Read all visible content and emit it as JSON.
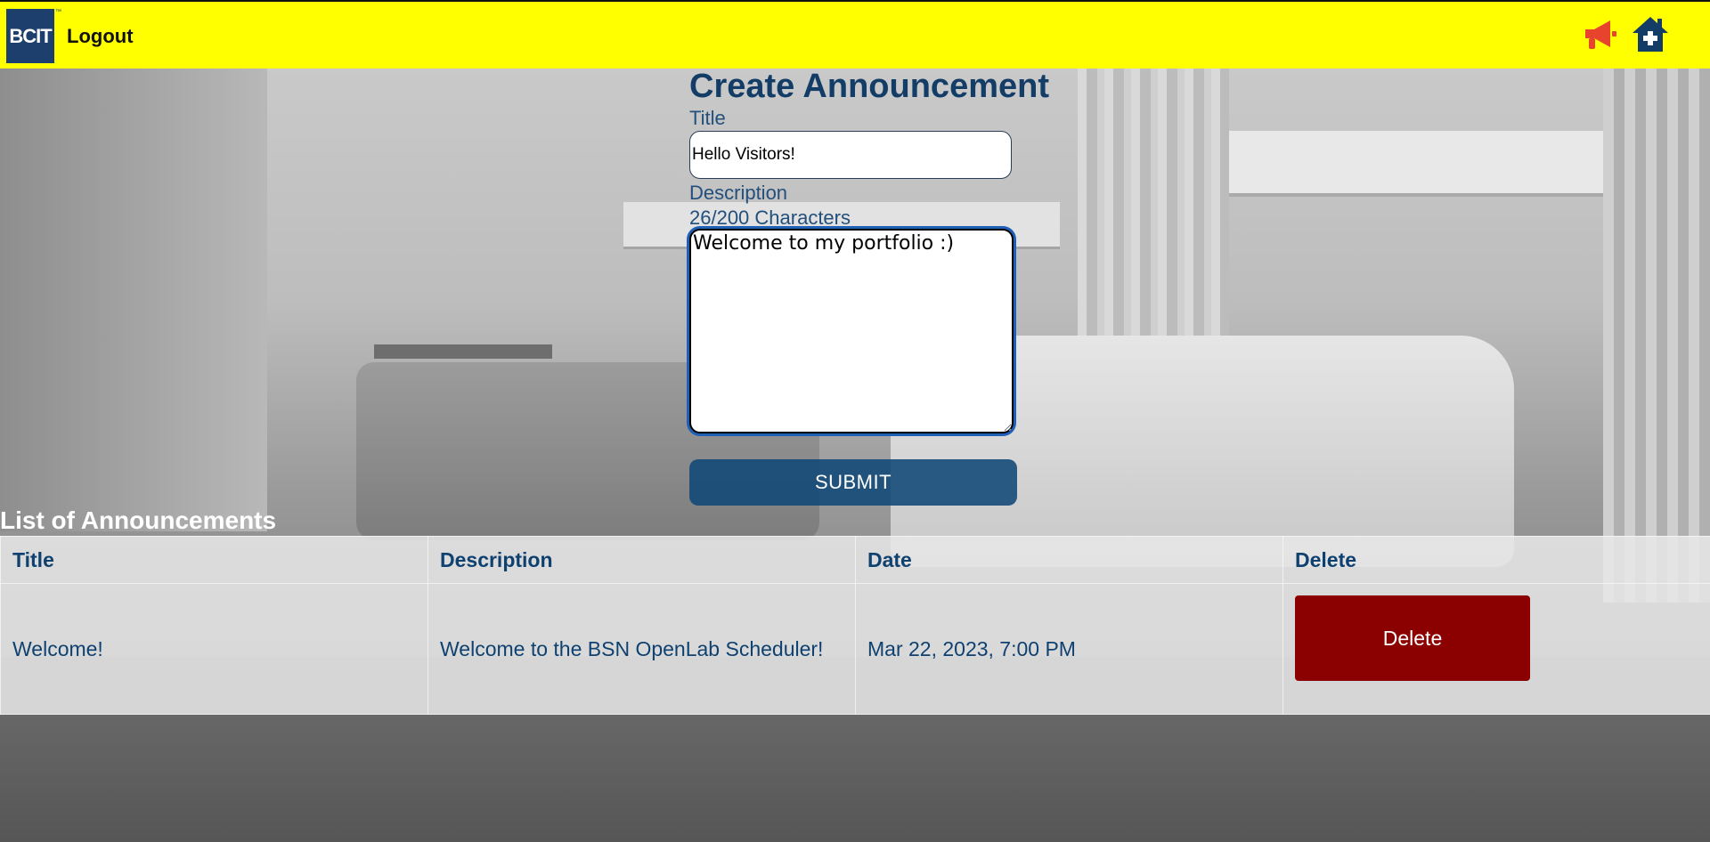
{
  "header": {
    "logo_text": "BCIT",
    "logo_tm": "™",
    "logout_label": "Logout",
    "icons": [
      "megaphone-icon",
      "home-plus-icon"
    ],
    "colors": {
      "background": "#ffff00",
      "megaphone": "#e8432d",
      "home": "#133c66"
    }
  },
  "form": {
    "heading": "Create Announcement",
    "title_label": "Title",
    "title_value": "Hello Visitors!",
    "description_label": "Description",
    "char_count": "26/200 Characters",
    "description_value": "Welcome to my portfolio :)",
    "submit_label": "SUBMIT"
  },
  "list": {
    "heading": "List of Announcements",
    "columns": [
      "Title",
      "Description",
      "Date",
      "Delete"
    ],
    "rows": [
      {
        "title": "Welcome!",
        "description": "Welcome to the BSN OpenLab Scheduler!",
        "date": "Mar 22, 2023, 7:00 PM",
        "delete_label": "Delete"
      }
    ]
  },
  "colors": {
    "accent_blue": "#133c66",
    "delete_red": "#8b0000",
    "submit_blue": "#104876"
  }
}
